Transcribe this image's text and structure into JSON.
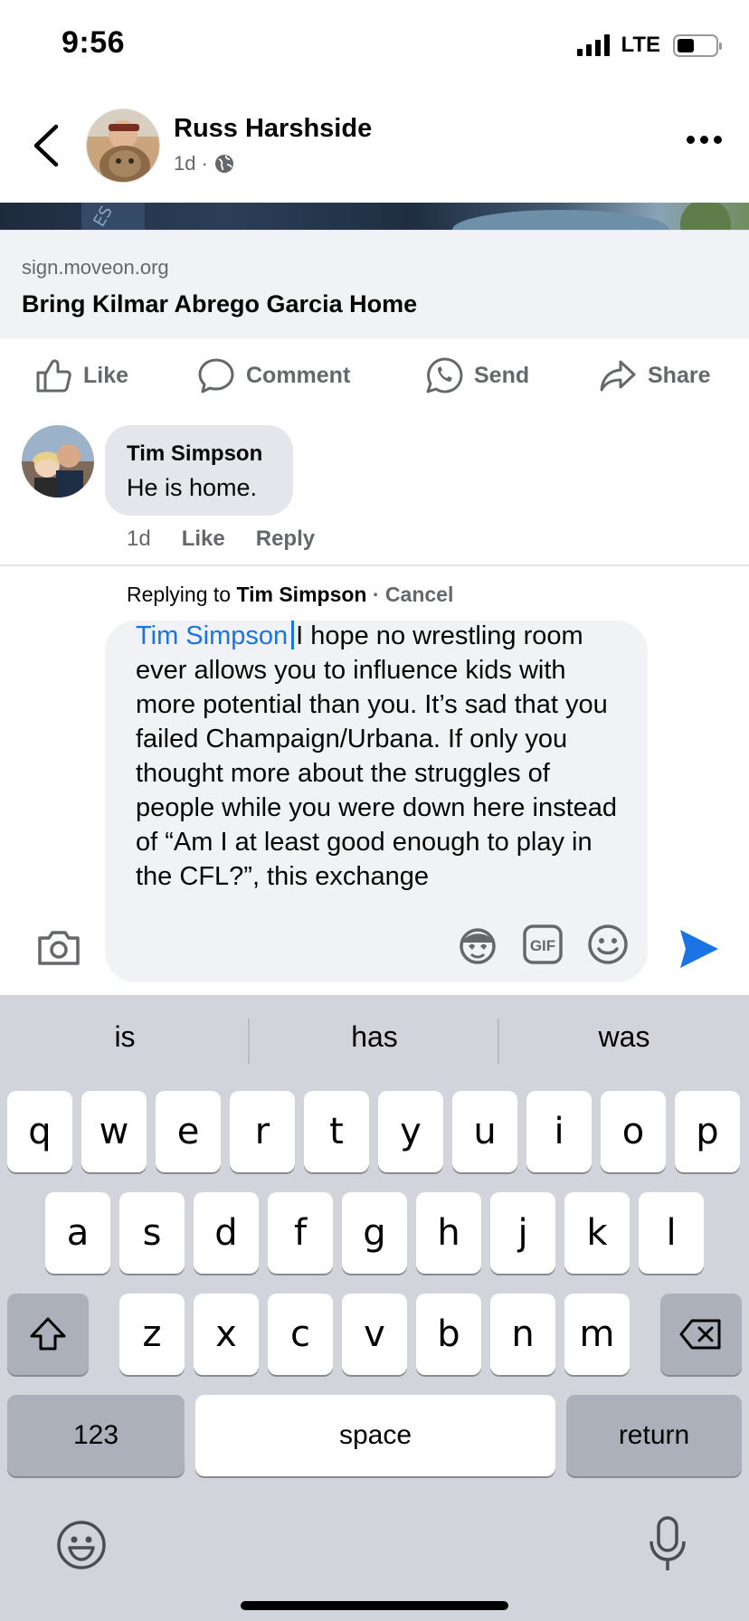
{
  "status": {
    "time": "9:56",
    "network": "LTE"
  },
  "post": {
    "author": "Russ Harshside",
    "age": "1d",
    "link_domain": "sign.moveon.org",
    "link_title": "Bring Kilmar Abrego Garcia Home"
  },
  "actions": {
    "like": "Like",
    "comment": "Comment",
    "send": "Send",
    "share": "Share"
  },
  "comment": {
    "author": "Tim Simpson",
    "text": "He is home.",
    "age": "1d",
    "like": "Like",
    "reply": "Reply"
  },
  "reply": {
    "prefix": "Replying to",
    "target": "Tim Simpson",
    "separator": "·",
    "cancel": "Cancel",
    "mention": "Tim Simpson",
    "text": "I hope no wrestling room ever allows you to influence kids with more potential than you. It’s sad that you failed Champaign/Urbana. If only you thought more about the struggles of people while you were down here instead of “Am I at least good enough to play in the CFL?”, this exchange"
  },
  "keyboard": {
    "suggestions": [
      "is",
      "has",
      "was"
    ],
    "row1": [
      "q",
      "w",
      "e",
      "r",
      "t",
      "y",
      "u",
      "i",
      "o",
      "p"
    ],
    "row2": [
      "a",
      "s",
      "d",
      "f",
      "g",
      "h",
      "j",
      "k",
      "l"
    ],
    "row3": [
      "z",
      "x",
      "c",
      "v",
      "b",
      "n",
      "m"
    ],
    "numbers": "123",
    "space": "space",
    "return": "return"
  },
  "colors": {
    "accent": "#1b74e4",
    "muted": "#65676b",
    "keyboard_bg": "#d1d4db"
  }
}
